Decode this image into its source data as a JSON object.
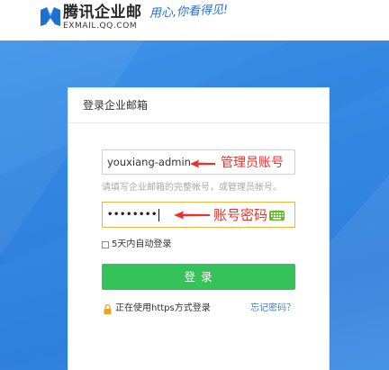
{
  "header": {
    "brand_name": "腾讯企业邮",
    "brand_domain": "EXMAIL.QQ.COM",
    "slogan": "用心,你看得见!"
  },
  "login": {
    "title": "登录企业邮箱",
    "username": {
      "value": "youxiang-admin",
      "hint": "请填写企业邮箱的完整帐号，或管理员帐号。"
    },
    "password": {
      "value": "••••••••"
    },
    "remember": {
      "label": "5天内自动登录",
      "checked": false
    },
    "submit_label": "登 录",
    "https_notice": "正在使用https方式登录",
    "forgot_password": "忘记密码？"
  },
  "annotations": {
    "username_note": "管理员账号",
    "password_note": "账号密码"
  },
  "icons": {
    "logo": "exmail-logo-icon",
    "keyboard": "keyboard-icon",
    "lock": "lock-icon",
    "annotation_arrow": "arrow-left-icon"
  },
  "colors": {
    "brand_blue": "#1f6fd2",
    "bg_blue": "#3387e2",
    "submit_green": "#35c259",
    "annotation_red": "#e8322b",
    "link_blue": "#3b7fd6",
    "focus_border": "#efb33b",
    "keyboard_green": "#5cbf2a",
    "lock_gold": "#e8a718"
  }
}
